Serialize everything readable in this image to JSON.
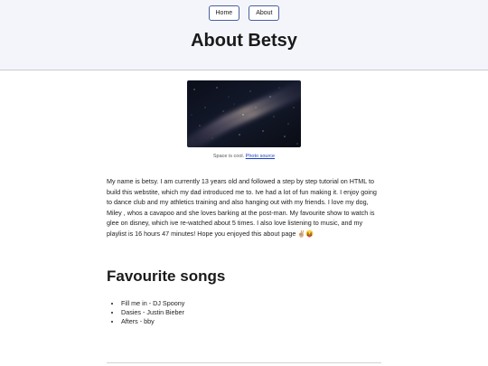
{
  "nav": {
    "home_label": "Home",
    "about_label": "About"
  },
  "page": {
    "title": "About Betsy"
  },
  "figure": {
    "image_name": "milky-way-night-sky",
    "caption_text": "Space is cool.",
    "caption_link": "Photo source"
  },
  "bio": {
    "text": "My name is betsy. I am currently 13 years old and followed a step by step tutorial on HTML to build this webstite, which my dad introduced me to. Ive had a lot of fun making it. I enjoy going to dance club and my athletics training and also hanging out with my friends. I love my dog, Miley , whos a cavapoo and she loves barking at the post-man. My favourite show to watch is glee on disney, which ive re-watched about 5 times. I also love listening to music, and my playlist is 16 hours 47 minutes! Hope you enjoyed this about page ✌🏼😝"
  },
  "songs": {
    "heading": "Favourite songs",
    "items": [
      "Fill me in - DJ Spoony",
      "Dasies - Justin Bieber",
      "Afters - bby"
    ]
  },
  "colors": {
    "header_bg": "#f3f5fb",
    "button_border": "#4a5fa0",
    "link": "#1a3fc0"
  }
}
